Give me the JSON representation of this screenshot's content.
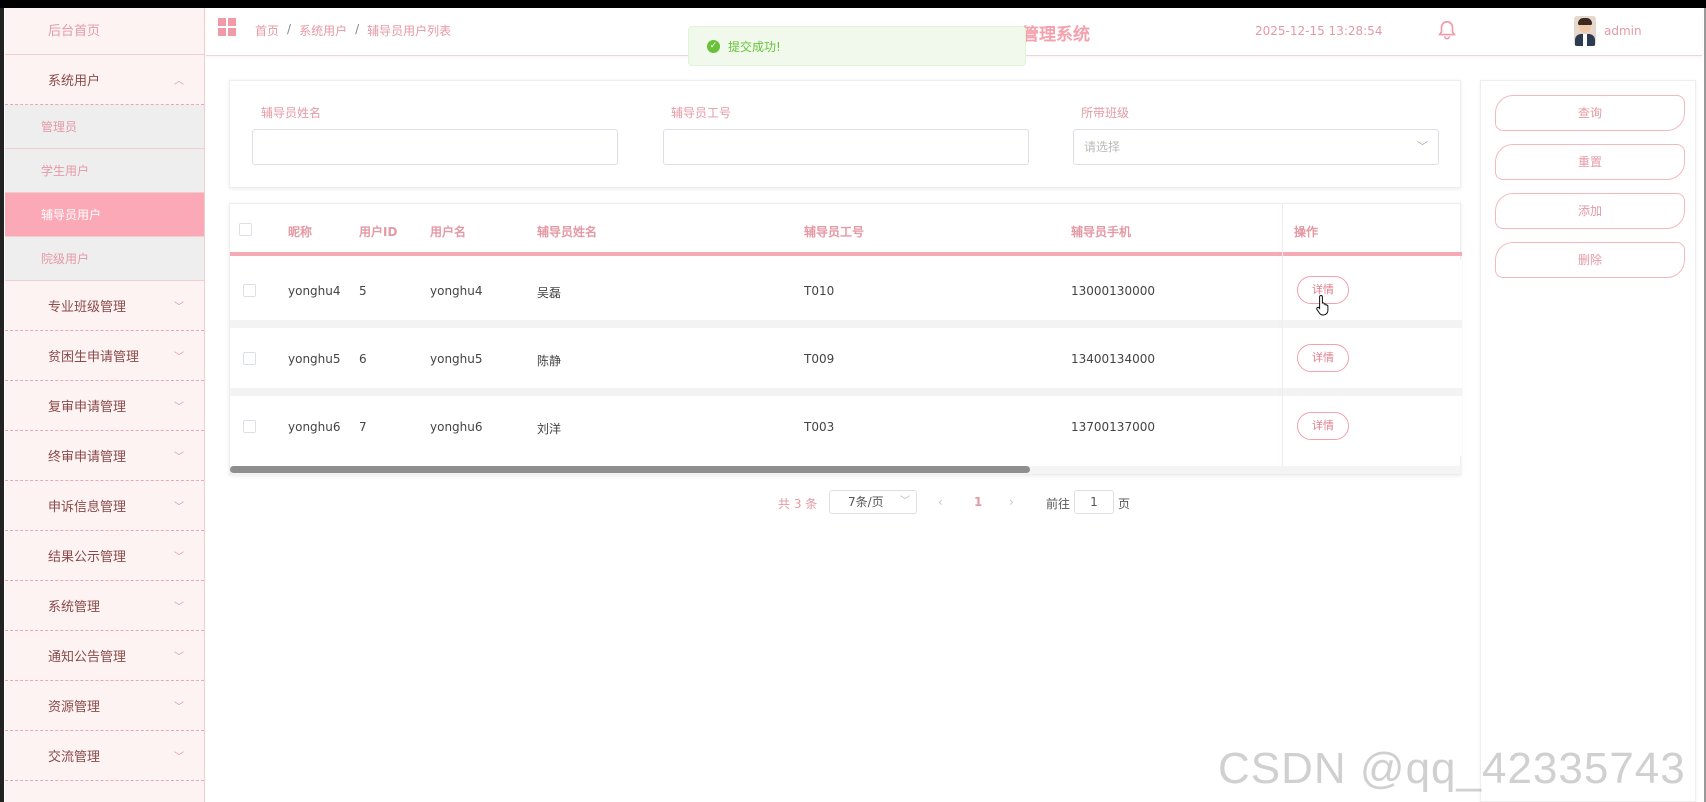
{
  "header": {
    "breadcrumb": [
      "首页",
      "系统用户",
      "辅导员用户列表"
    ],
    "title": "管理系统",
    "datetime": "2025-12-15 13:28:54",
    "username": "admin"
  },
  "toast": {
    "message": "提交成功!"
  },
  "sidebar": {
    "home": "后台首页",
    "groups": [
      {
        "label": "系统用户",
        "expanded": true,
        "children": [
          "管理员",
          "学生用户",
          "辅导员用户",
          "院级用户"
        ],
        "active_child": "辅导员用户"
      },
      {
        "label": "专业班级管理"
      },
      {
        "label": "贫困生申请管理"
      },
      {
        "label": "复审申请管理"
      },
      {
        "label": "终审申请管理"
      },
      {
        "label": "申诉信息管理"
      },
      {
        "label": "结果公示管理"
      },
      {
        "label": "系统管理"
      },
      {
        "label": "通知公告管理"
      },
      {
        "label": "资源管理"
      },
      {
        "label": "交流管理"
      }
    ]
  },
  "search": {
    "name_label": "辅导员姓名",
    "name_value": "",
    "id_label": "辅导员工号",
    "id_value": "",
    "class_label": "所带班级",
    "class_placeholder": "请选择"
  },
  "actions": {
    "query": "查询",
    "reset": "重置",
    "add": "添加",
    "delete": "删除"
  },
  "table": {
    "columns": [
      "昵称",
      "用户ID",
      "用户名",
      "辅导员姓名",
      "辅导员工号",
      "辅导员手机",
      "操作"
    ],
    "rows": [
      {
        "nickname": "yonghu4",
        "user_id": "5",
        "username": "yonghu4",
        "name": "吴磊",
        "staff_no": "T010",
        "phone": "13000130000",
        "op": "详情"
      },
      {
        "nickname": "yonghu5",
        "user_id": "6",
        "username": "yonghu5",
        "name": "陈静",
        "staff_no": "T009",
        "phone": "13400134000",
        "op": "详情"
      },
      {
        "nickname": "yonghu6",
        "user_id": "7",
        "username": "yonghu6",
        "name": "刘洋",
        "staff_no": "T003",
        "phone": "13700137000",
        "op": "详情"
      }
    ]
  },
  "pagination": {
    "total": "共 3 条",
    "page_size": "7条/页",
    "prev": "‹",
    "current": "1",
    "next": "›",
    "goto_label": "前往",
    "goto_value": "1",
    "page_suffix": "页"
  },
  "watermark": "CSDN @qq_42335743",
  "colors": {
    "accent": "#f4a1ad",
    "active_bg": "#fba9b6",
    "success": "#67c23a"
  }
}
